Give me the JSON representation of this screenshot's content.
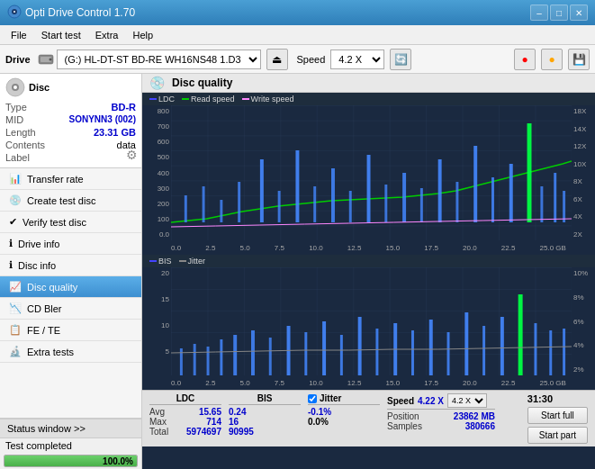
{
  "titlebar": {
    "icon": "💿",
    "title": "Opti Drive Control 1.70",
    "minimize": "–",
    "maximize": "□",
    "close": "✕"
  },
  "menubar": {
    "items": [
      "File",
      "Start test",
      "Extra",
      "Help"
    ]
  },
  "toolbar": {
    "drive_label": "Drive",
    "drive_value": "(G:)  HL-DT-ST BD-RE  WH16NS48 1.D3",
    "speed_label": "Speed",
    "speed_value": "4.2 X"
  },
  "disc": {
    "label": "Disc",
    "type_label": "Type",
    "type_value": "BD-R",
    "mid_label": "MID",
    "mid_value": "SONYNN3 (002)",
    "length_label": "Length",
    "length_value": "23.31 GB",
    "contents_label": "Contents",
    "contents_value": "data",
    "label_label": "Label",
    "label_value": ""
  },
  "nav": {
    "items": [
      {
        "id": "transfer-rate",
        "label": "Transfer rate",
        "icon": "📊"
      },
      {
        "id": "create-test-disc",
        "label": "Create test disc",
        "icon": "💿"
      },
      {
        "id": "verify-test-disc",
        "label": "Verify test disc",
        "icon": "✔"
      },
      {
        "id": "drive-info",
        "label": "Drive info",
        "icon": "ℹ"
      },
      {
        "id": "disc-info",
        "label": "Disc info",
        "icon": "ℹ"
      },
      {
        "id": "disc-quality",
        "label": "Disc quality",
        "icon": "📈",
        "active": true
      },
      {
        "id": "cd-bler",
        "label": "CD Bler",
        "icon": "📉"
      },
      {
        "id": "fe-te",
        "label": "FE / TE",
        "icon": "📋"
      },
      {
        "id": "extra-tests",
        "label": "Extra tests",
        "icon": "🔬"
      }
    ]
  },
  "status": {
    "window_label": "Status window >>",
    "completed_label": "Test completed",
    "progress_percent": "100.0%",
    "progress_width": "100"
  },
  "chart": {
    "title": "Disc quality",
    "legend_top": [
      {
        "label": "LDC",
        "color": "#4444ff"
      },
      {
        "label": "Read speed",
        "color": "#00ff00"
      },
      {
        "label": "Write speed",
        "color": "#ff00ff"
      }
    ],
    "legend_bottom": [
      {
        "label": "BIS",
        "color": "#4444ff"
      },
      {
        "label": "Jitter",
        "color": "#888888"
      }
    ],
    "y_axis_top": [
      "800",
      "700",
      "600",
      "500",
      "400",
      "300",
      "200",
      "100",
      "0.0"
    ],
    "y_axis_top_right": [
      "18X",
      "14X",
      "12X",
      "10X",
      "8X",
      "6X",
      "4X",
      "2X"
    ],
    "y_axis_bottom": [
      "20",
      "15",
      "10",
      "5"
    ],
    "y_axis_bottom_right": [
      "10%",
      "8%",
      "6%",
      "4%",
      "2%"
    ],
    "x_axis": [
      "0.0",
      "2.5",
      "5.0",
      "7.5",
      "10.0",
      "12.5",
      "15.0",
      "17.5",
      "20.0",
      "22.5",
      "25.0 GB"
    ]
  },
  "stats": {
    "ldc_header": "LDC",
    "bis_header": "BIS",
    "jitter_header": "Jitter",
    "jitter_checked": true,
    "speed_header": "Speed",
    "position_header": "Position",
    "samples_header": "Samples",
    "avg_label": "Avg",
    "max_label": "Max",
    "total_label": "Total",
    "ldc_avg": "15.65",
    "ldc_max": "714",
    "ldc_total": "5974697",
    "bis_avg": "0.24",
    "bis_max": "16",
    "bis_total": "90995",
    "jitter_avg": "-0.1%",
    "jitter_max": "0.0%",
    "jitter_total": "",
    "speed_value": "4.22 X",
    "speed_select": "4.2 X",
    "position_value": "23862 MB",
    "samples_value": "380666",
    "start_full_label": "Start full",
    "start_part_label": "Start part",
    "time_value": "31:30"
  }
}
